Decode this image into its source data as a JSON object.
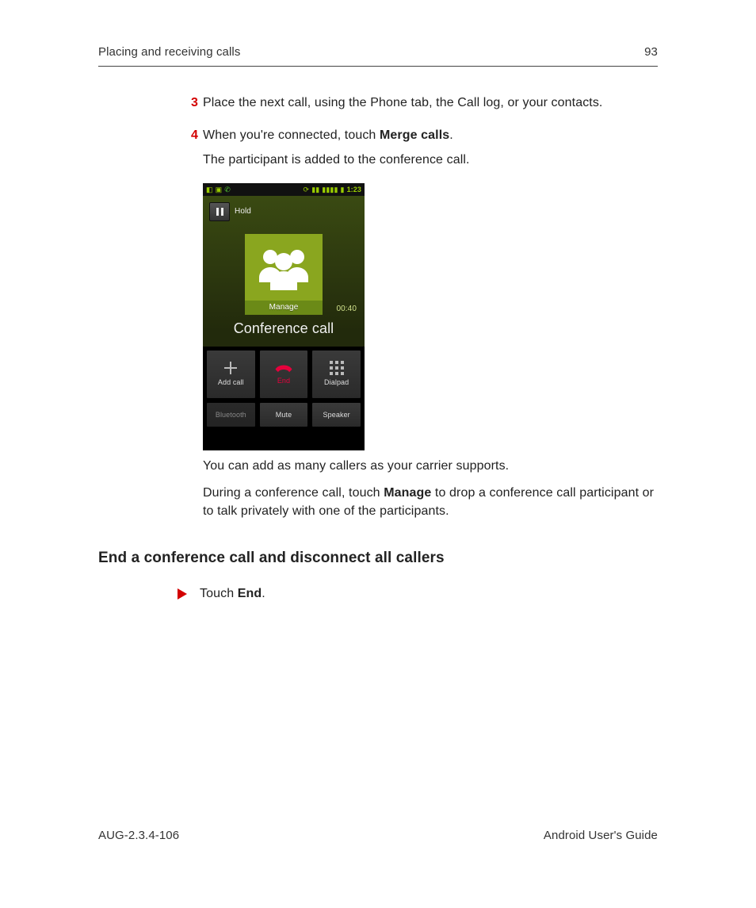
{
  "header": {
    "section": "Placing and receiving calls",
    "page_number": "93"
  },
  "steps": {
    "s3": {
      "num": "3",
      "text": "Place the next call, using the Phone tab, the Call log, or your contacts."
    },
    "s4": {
      "num": "4",
      "text_before": "When you're connected, touch ",
      "bold": "Merge calls",
      "text_after": ".",
      "result": "The participant is added to the conference call."
    }
  },
  "phone": {
    "status_time": "1:23",
    "hold_label": "Hold",
    "manage_label": "Manage",
    "call_duration": "00:40",
    "call_title": "Conference call",
    "buttons": {
      "add_call": "Add call",
      "end": "End",
      "dialpad": "Dialpad",
      "bluetooth": "Bluetooth",
      "mute": "Mute",
      "speaker": "Speaker"
    }
  },
  "after_phone": {
    "line1": "You can add as many callers as your carrier supports.",
    "line2_before": "During a conference call, touch ",
    "line2_bold": "Manage",
    "line2_after": " to drop a conference call participant or to talk privately with one of the participants."
  },
  "section_heading": "End a conference call and disconnect all callers",
  "bullet": {
    "before": "Touch ",
    "bold": "End",
    "after": "."
  },
  "footer": {
    "doc_id": "AUG-2.3.4-106",
    "doc_title": "Android User's Guide"
  }
}
